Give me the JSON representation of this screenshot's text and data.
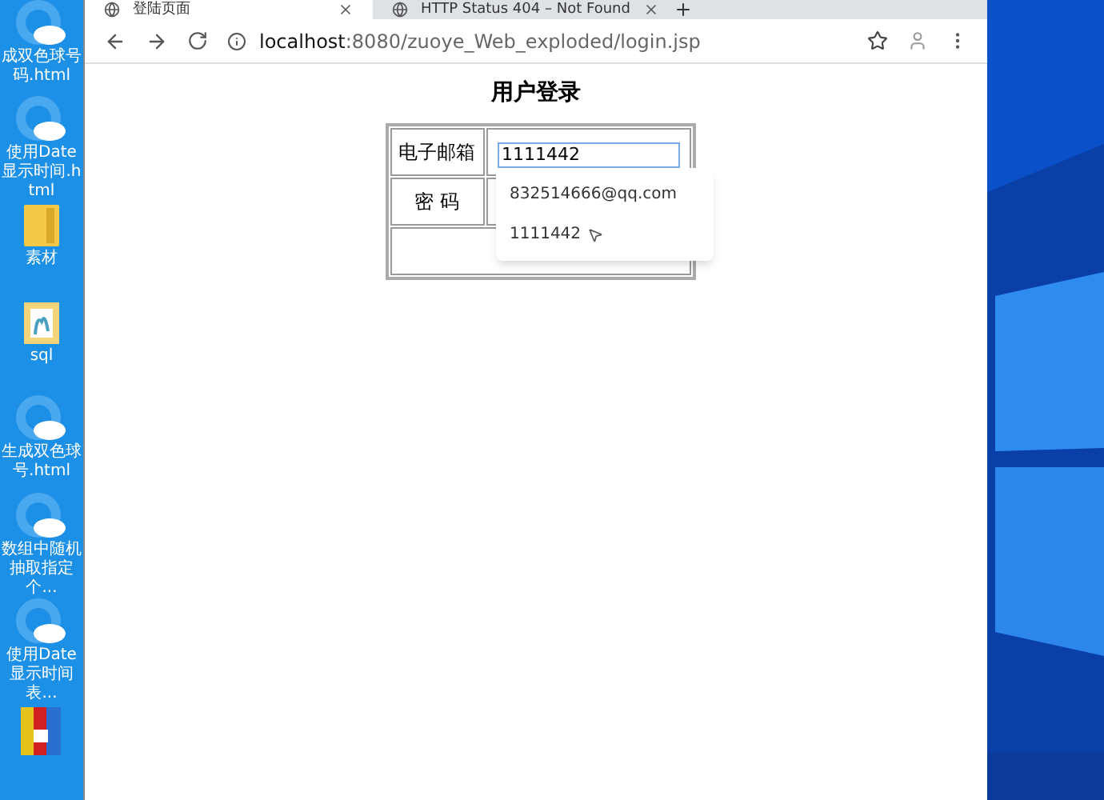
{
  "desktop_icons": [
    {
      "kind": "browser",
      "label": "成双色球号码.html"
    },
    {
      "kind": "browser",
      "label": "使用Date显示时间.html"
    },
    {
      "kind": "folder",
      "label": "素材"
    },
    {
      "kind": "file",
      "label": "sql"
    },
    {
      "kind": "browser",
      "label": "生成双色球号.html"
    },
    {
      "kind": "browser",
      "label": "数组中随机抽取指定个..."
    },
    {
      "kind": "browser",
      "label": "使用Date显示时间表..."
    },
    {
      "kind": "archive"
    }
  ],
  "tabs": [
    {
      "title": "登陆页面",
      "selected": true
    },
    {
      "title": "HTTP Status 404 – Not Found",
      "selected": false
    }
  ],
  "address": {
    "host": "localhost",
    "path": ":8080/zuoye_Web_exploded/login.jsp"
  },
  "page": {
    "title": "用户登录",
    "email_label": "电子邮箱",
    "email_value": "1111442",
    "password_label": "密 码"
  },
  "autocomplete": [
    "832514666@qq.com",
    "1111442"
  ]
}
